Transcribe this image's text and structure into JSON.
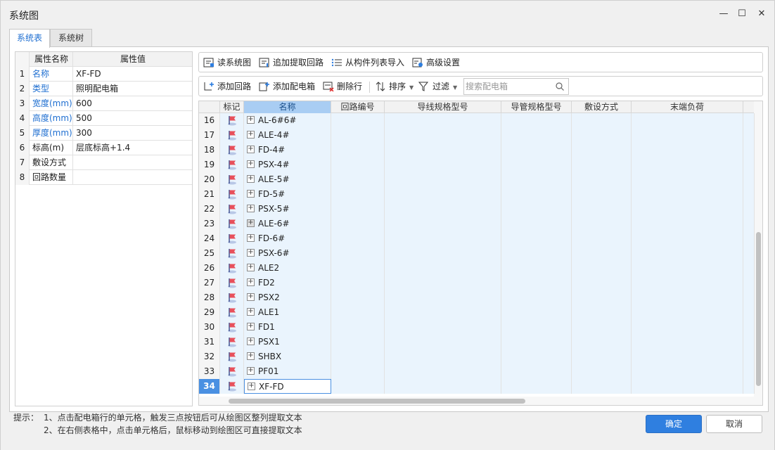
{
  "window": {
    "title": "系统图",
    "minimize_glyph": "—",
    "maximize_glyph": "☐",
    "close_glyph": "✕"
  },
  "tabs": [
    {
      "label": "系统表",
      "active": true
    },
    {
      "label": "系统树",
      "active": false
    }
  ],
  "properties": {
    "headers": [
      "属性名称",
      "属性值"
    ],
    "rows": [
      {
        "num": "1",
        "name": "名称",
        "value": "XF-FD",
        "blue": true
      },
      {
        "num": "2",
        "name": "类型",
        "value": "照明配电箱",
        "blue": true
      },
      {
        "num": "3",
        "name": "宽度(mm)",
        "value": "600",
        "blue": true
      },
      {
        "num": "4",
        "name": "高度(mm)",
        "value": "500",
        "blue": true
      },
      {
        "num": "5",
        "name": "厚度(mm)",
        "value": "300",
        "blue": true
      },
      {
        "num": "6",
        "name": "标高(m)",
        "value": "层底标高+1.4",
        "blue": false
      },
      {
        "num": "7",
        "name": "敷设方式",
        "value": "",
        "blue": false
      },
      {
        "num": "8",
        "name": "回路数量",
        "value": "",
        "blue": false
      }
    ]
  },
  "toolbar1": {
    "read_label": "读系统图",
    "add_extract_label": "追加提取回路",
    "import_label": "从构件列表导入",
    "advanced_label": "高级设置"
  },
  "toolbar2": {
    "add_circuit_label": "添加回路",
    "add_box_label": "添加配电箱",
    "delete_row_label": "删除行",
    "sort_label": "排序",
    "filter_label": "过滤",
    "search_placeholder": "搜索配电箱"
  },
  "grid": {
    "headers": [
      "",
      "标记",
      "名称",
      "回路编号",
      "导线规格型号",
      "导管规格型号",
      "敷设方式",
      "末端负荷"
    ],
    "rows": [
      {
        "num": "16",
        "name": "AL-6#6#"
      },
      {
        "num": "17",
        "name": "ALE-4#"
      },
      {
        "num": "18",
        "name": "FD-4#"
      },
      {
        "num": "19",
        "name": "PSX-4#"
      },
      {
        "num": "20",
        "name": "ALE-5#"
      },
      {
        "num": "21",
        "name": "FD-5#"
      },
      {
        "num": "22",
        "name": "PSX-5#"
      },
      {
        "num": "23",
        "name": "ALE-6#"
      },
      {
        "num": "24",
        "name": "FD-6#"
      },
      {
        "num": "25",
        "name": "PSX-6#"
      },
      {
        "num": "26",
        "name": "ALE2"
      },
      {
        "num": "27",
        "name": "FD2"
      },
      {
        "num": "28",
        "name": "PSX2"
      },
      {
        "num": "29",
        "name": "ALE1"
      },
      {
        "num": "30",
        "name": "FD1"
      },
      {
        "num": "31",
        "name": "PSX1"
      },
      {
        "num": "32",
        "name": "SHBX"
      },
      {
        "num": "33",
        "name": "PF01"
      },
      {
        "num": "34",
        "name": "XF-FD"
      }
    ],
    "current_row": "34",
    "hover_row": "23",
    "expand_glyph": "+"
  },
  "tips": {
    "label": "提示：",
    "line1": "1、点击配电箱行的单元格，触发三点按钮后可从绘图区整列提取文本",
    "line2": "2、在右侧表格中，点击单元格后，鼠标移动到绘图区可直接提取文本"
  },
  "buttons": {
    "ok": "确定",
    "cancel": "取消"
  },
  "colors": {
    "accent": "#2f7fe0",
    "label_blue": "#1f6fd1",
    "row_tint": "#eaf4fd"
  }
}
